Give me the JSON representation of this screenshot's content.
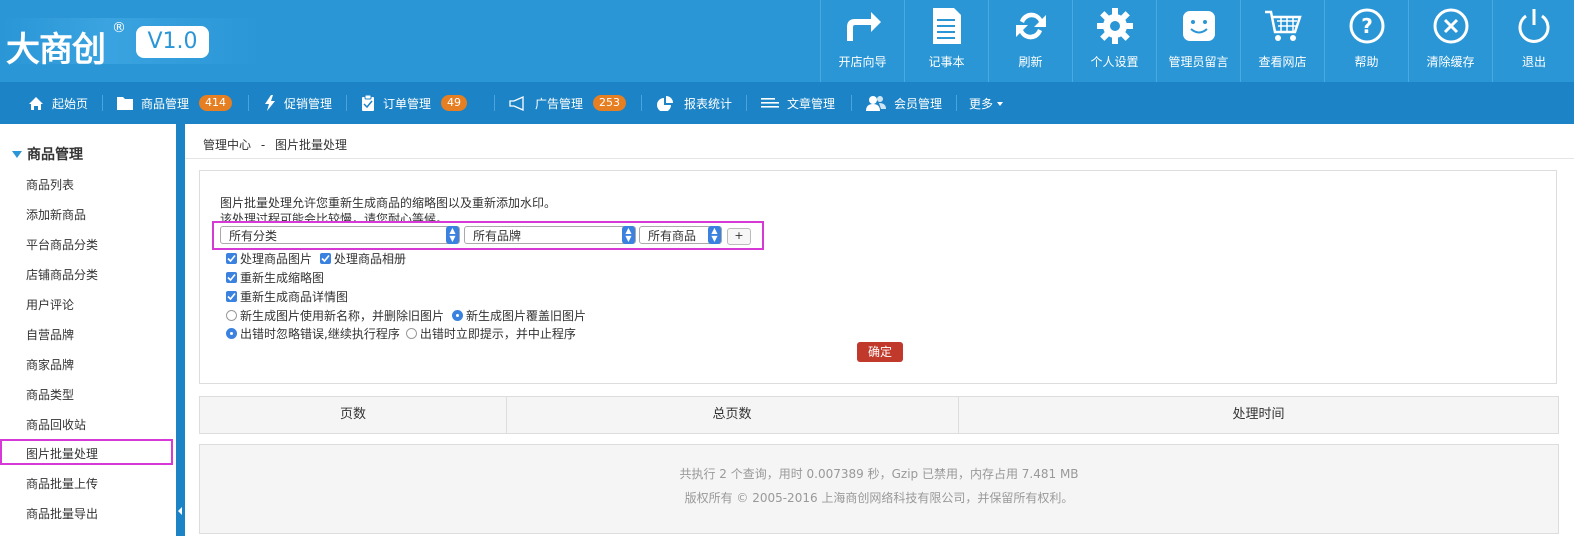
{
  "brand": {
    "name": "大商创",
    "reg": "®",
    "version": "V1.0"
  },
  "toolbar": [
    {
      "label": "开店向导",
      "icon": "share-arrow-icon"
    },
    {
      "label": "记事本",
      "icon": "notepad-icon"
    },
    {
      "label": "刷新",
      "icon": "refresh-icon"
    },
    {
      "label": "个人设置",
      "icon": "gear-icon"
    },
    {
      "label": "管理员留言",
      "icon": "smiley-message-icon"
    },
    {
      "label": "查看网店",
      "icon": "cart-icon"
    },
    {
      "label": "帮助",
      "icon": "help-icon"
    },
    {
      "label": "清除缓存",
      "icon": "clear-cache-icon"
    },
    {
      "label": "退出",
      "icon": "power-icon"
    }
  ],
  "nav": {
    "home": "起始页",
    "goods": "商品管理",
    "goods_badge": "414",
    "promo": "促销管理",
    "orders": "订单管理",
    "orders_badge": "49",
    "ads": "广告管理",
    "ads_badge": "253",
    "reports": "报表统计",
    "articles": "文章管理",
    "members": "会员管理",
    "more": "更多"
  },
  "sidebar": {
    "title": "商品管理",
    "items": [
      "商品列表",
      "添加新商品",
      "平台商品分类",
      "店铺商品分类",
      "用户评论",
      "自营品牌",
      "商家品牌",
      "商品类型",
      "商品回收站",
      "图片批量处理",
      "商品批量上传",
      "商品批量导出"
    ]
  },
  "breadcrumb": {
    "root": "管理中心",
    "sep": "-",
    "current": "图片批量处理"
  },
  "form": {
    "desc1": "图片批量处理允许您重新生成商品的缩略图以及重新添加水印。",
    "desc2": "该处理过程可能会比较慢，请您耐心等候。",
    "category_select": "所有分类",
    "brand_select": "所有品牌",
    "goods_select": "所有商品",
    "plus": "+",
    "cb_goods_img": "处理商品图片",
    "cb_gallery": "处理商品相册",
    "cb_thumb": "重新生成缩略图",
    "cb_detail": "重新生成商品详情图",
    "rb_new_name": "新生成图片使用新名称，并删除旧图片",
    "rb_overwrite": "新生成图片覆盖旧图片",
    "rb_ignore": "出错时忽略错误,继续执行程序",
    "rb_stop": "出错时立即提示，并中止程序",
    "submit": "确定"
  },
  "table": {
    "headers": [
      "页数",
      "总页数",
      "处理时间"
    ]
  },
  "footer": {
    "line1": "共执行 2 个查询，用时 0.007389 秒，Gzip 已禁用，内存占用 7.481 MB",
    "line2": "版权所有 © 2005-2016 上海商创网络科技有限公司，并保留所有权利。"
  }
}
